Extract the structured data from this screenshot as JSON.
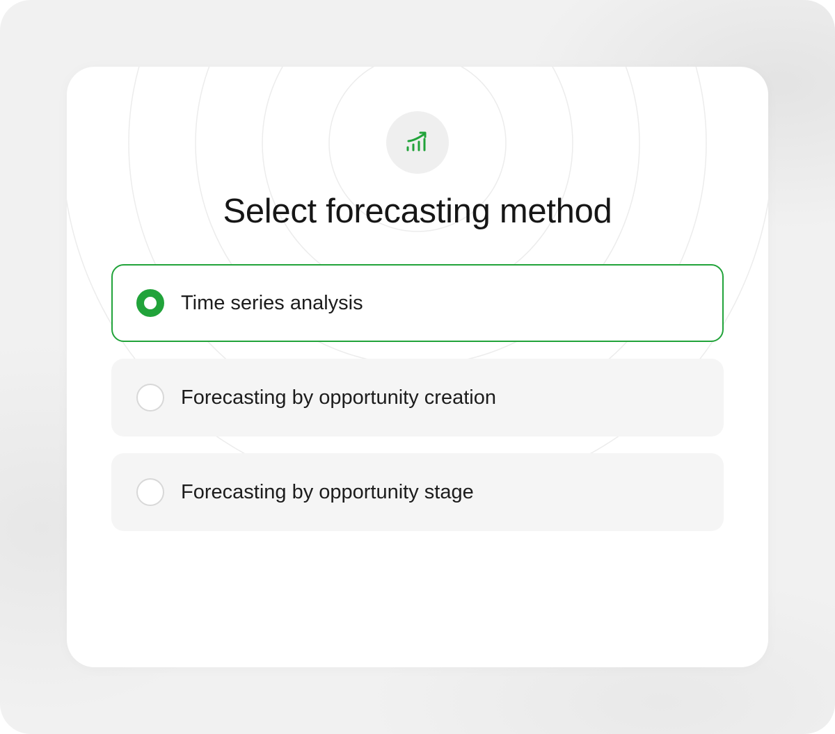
{
  "dialog": {
    "icon": "trending-chart-icon",
    "title": "Select forecasting method"
  },
  "options": [
    {
      "label": "Time series analysis",
      "selected": true
    },
    {
      "label": "Forecasting by opportunity creation",
      "selected": false
    },
    {
      "label": "Forecasting by opportunity stage",
      "selected": false
    }
  ],
  "colors": {
    "accent": "#21a33a",
    "option_background": "#f5f5f5",
    "card_background": "#ffffff",
    "page_background": "#f1f1f1"
  }
}
